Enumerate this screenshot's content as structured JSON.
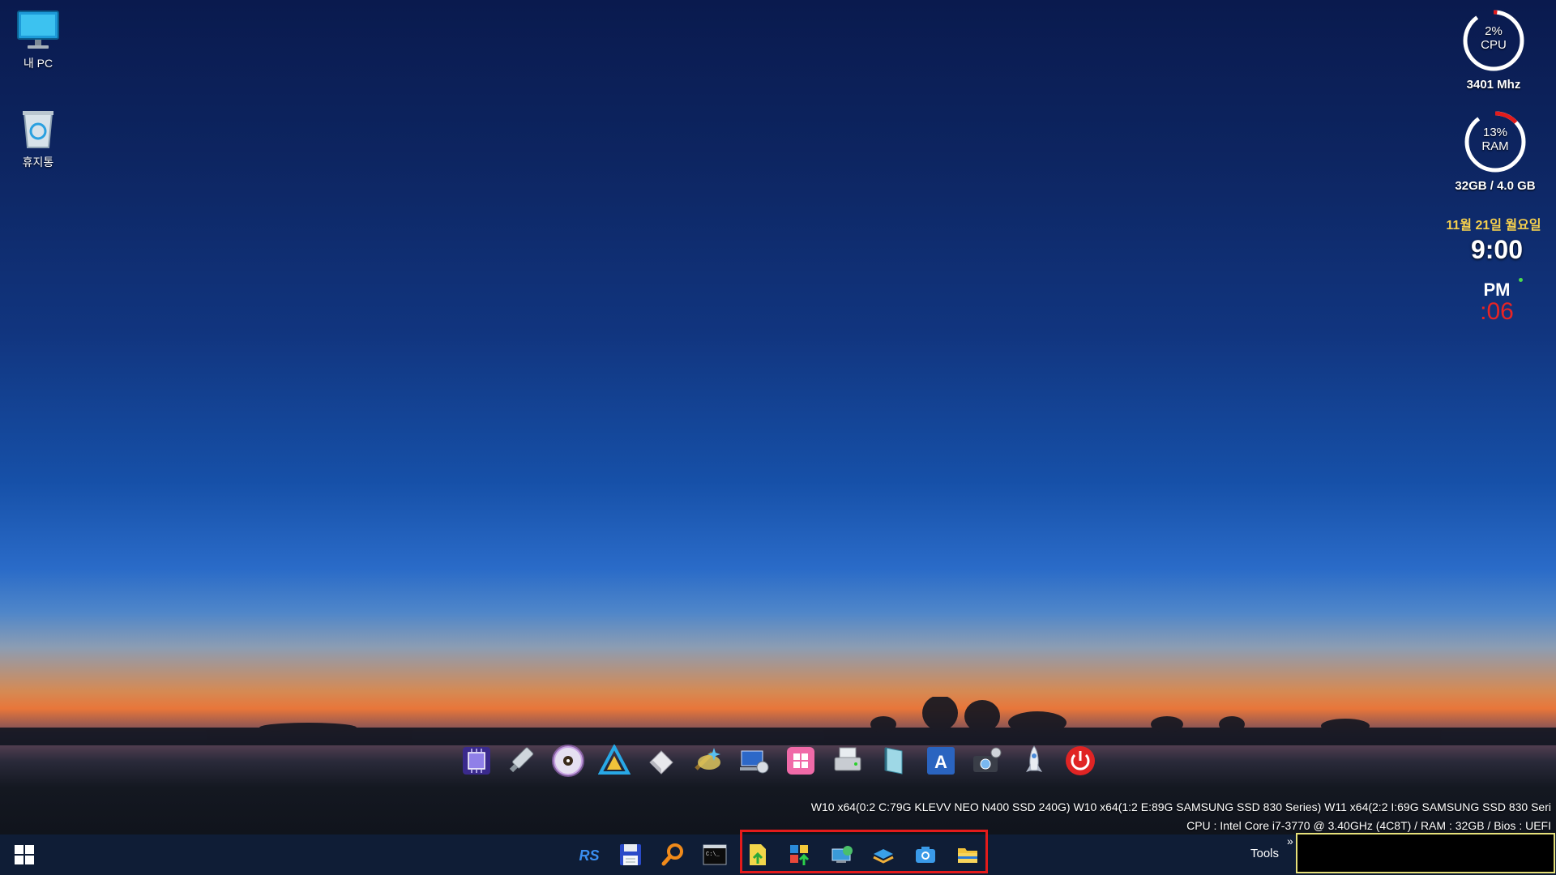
{
  "desktop_icons": [
    {
      "label": "내 PC",
      "icon": "monitor-icon"
    },
    {
      "label": "휴지통",
      "icon": "recycle-bin-icon"
    }
  ],
  "cpu_gauge": {
    "percent_text": "2%",
    "label": "CPU",
    "sub": "3401 Mhz",
    "value": 2
  },
  "ram_gauge": {
    "percent_text": "13%",
    "label": "RAM",
    "sub": "32GB / 4.0 GB",
    "value": 13
  },
  "clock": {
    "date": "11월 21일 월요일",
    "time": "9:00",
    "ampm": "PM",
    "seconds": ":06"
  },
  "dock": [
    {
      "icon": "cpu-chip-icon"
    },
    {
      "icon": "usb-drive-icon"
    },
    {
      "icon": "disc-icon"
    },
    {
      "icon": "triangle-logo-icon"
    },
    {
      "icon": "eraser-icon"
    },
    {
      "icon": "magic-wand-icon"
    },
    {
      "icon": "network-computer-icon"
    },
    {
      "icon": "windows-pink-icon"
    },
    {
      "icon": "disk-tool-icon"
    },
    {
      "icon": "book-icon"
    },
    {
      "icon": "font-a-icon"
    },
    {
      "icon": "camera-settings-icon"
    },
    {
      "icon": "rocket-icon"
    },
    {
      "icon": "power-icon"
    }
  ],
  "info": {
    "line1": "W10   x64(0:2 C:79G KLEVV NEO N400 SSD 240G) W10   x64(1:2 E:89G SAMSUNG SSD 830 Series) W11   x64(2:2 I:69G SAMSUNG SSD 830 Seri",
    "line2": "CPU : Intel Core i7-3770 @ 3.40GHz (4C8T) / RAM : 32GB / Bios : UEFI"
  },
  "taskbar": {
    "start_icon": "windows-start-icon",
    "pinned": [
      {
        "icon": "rs-logo-icon"
      },
      {
        "icon": "save-floppy-icon"
      },
      {
        "icon": "search-icon"
      },
      {
        "icon": "terminal-icon"
      }
    ],
    "highlighted": [
      {
        "icon": "file-upload-icon"
      },
      {
        "icon": "grid-upload-icon"
      },
      {
        "icon": "network-icon"
      },
      {
        "icon": "book-stack-icon"
      },
      {
        "icon": "camera-icon"
      },
      {
        "icon": "folder-icon"
      }
    ],
    "tools_label": "Tools",
    "chevron": "»"
  },
  "colors": {
    "accent_red": "#e31b1b",
    "date_yellow": "#f6d04d",
    "gauge_white": "#ffffff"
  }
}
